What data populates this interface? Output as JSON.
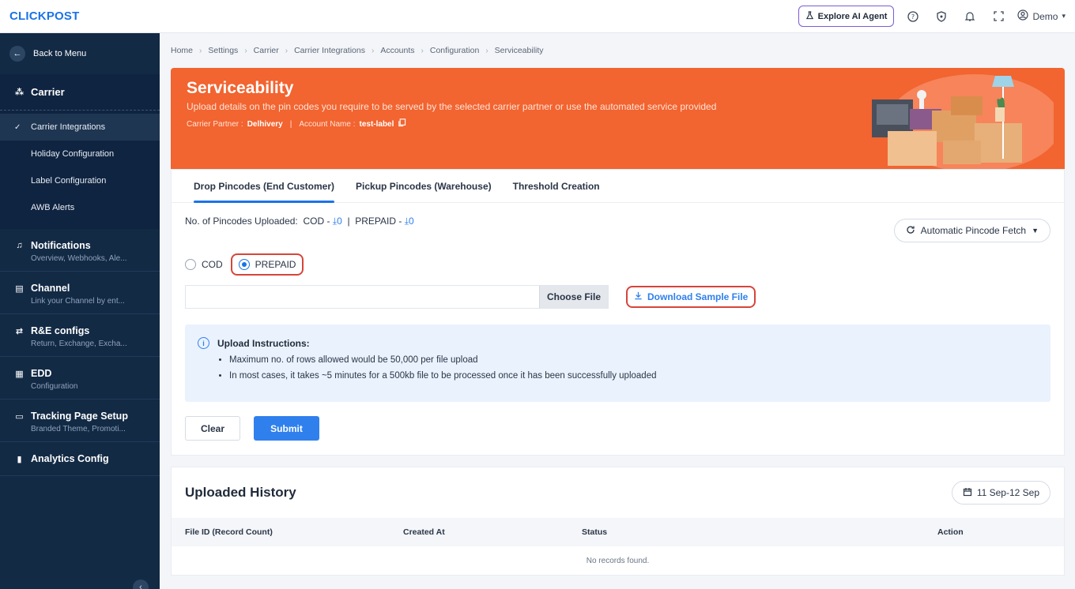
{
  "header": {
    "logo_a": "CLICK",
    "logo_b": "POST",
    "ai_agent": "Explore AI Agent",
    "user": "Demo"
  },
  "sidebar": {
    "back": "Back to Menu",
    "section": "Carrier",
    "sub_items": [
      {
        "label": "Carrier Integrations",
        "active": true
      },
      {
        "label": "Holiday Configuration"
      },
      {
        "label": "Label Configuration"
      },
      {
        "label": "AWB Alerts"
      }
    ],
    "groups": [
      {
        "title": "Notifications",
        "subtitle": "Overview, Webhooks, Ale..."
      },
      {
        "title": "Channel",
        "subtitle": "Link your Channel by ent..."
      },
      {
        "title": "R&E configs",
        "subtitle": "Return, Exchange, Excha..."
      },
      {
        "title": "EDD",
        "subtitle": "Configuration"
      },
      {
        "title": "Tracking Page Setup",
        "subtitle": "Branded Theme, Promoti..."
      },
      {
        "title": "Analytics Config",
        "subtitle": ""
      }
    ]
  },
  "breadcrumb": [
    "Home",
    "Settings",
    "Carrier",
    "Carrier Integrations",
    "Accounts",
    "Configuration",
    "Serviceability"
  ],
  "banner": {
    "title": "Serviceability",
    "description": "Upload details on the pin codes you require to be served by the selected carrier partner or use the automated service provided",
    "carrier_label": "Carrier Partner :",
    "carrier_value": "Delhivery",
    "account_label": "Account Name :",
    "account_value": "test-label"
  },
  "tabs": [
    "Drop Pincodes (End Customer)",
    "Pickup Pincodes (Warehouse)",
    "Threshold Creation"
  ],
  "upload": {
    "count_label": "No. of Pincodes Uploaded:",
    "cod_label": "COD -",
    "cod_count": "0",
    "prepaid_label": "PREPAID -",
    "prepaid_count": "0",
    "auto_fetch": "Automatic Pincode Fetch",
    "radio_cod": "COD",
    "radio_prepaid": "PREPAID",
    "choose_file": "Choose File",
    "download_sample": "Download Sample File",
    "instructions_title": "Upload Instructions:",
    "instructions": [
      "Maximum no. of rows allowed would be 50,000 per file upload",
      "In most cases, it takes ~5 minutes for a 500kb file to be processed once it has been successfully uploaded"
    ],
    "clear": "Clear",
    "submit": "Submit"
  },
  "history": {
    "title": "Uploaded History",
    "date_range": "11 Sep-12 Sep",
    "columns": [
      "File ID (Record Count)",
      "Created At",
      "Status",
      "Action"
    ],
    "empty": "No records found."
  },
  "colors": {
    "accent": "#2f80ed",
    "banner": "#f26430",
    "sidebar": "#132a45",
    "highlight": "#d6453a"
  }
}
